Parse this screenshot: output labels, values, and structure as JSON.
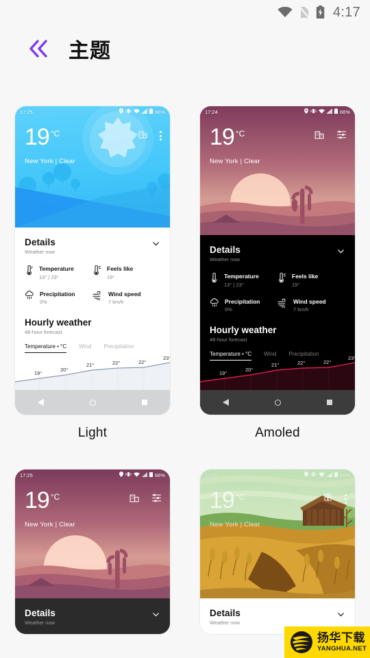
{
  "status_bar": {
    "time": "4:17",
    "icons": [
      "wifi-icon",
      "sim-off-icon",
      "battery-charging-icon"
    ]
  },
  "app_bar": {
    "back_label": "«",
    "title": "主题"
  },
  "preview": {
    "mini_status": {
      "battery": "66%",
      "icons": [
        "location-icon",
        "vibrate-icon",
        "wifi-icon",
        "signal-icon",
        "battery-icon"
      ]
    },
    "temperature": "19",
    "unit": "°C",
    "location": "New York | Clear",
    "details": {
      "title": "Details",
      "subtitle": "Weather now",
      "items": [
        {
          "icon": "thermometer-icon",
          "label": "Temperature",
          "value": "13° | 23°"
        },
        {
          "icon": "feels-like-icon",
          "label": "Feels like",
          "value": "19°"
        },
        {
          "icon": "precipitation-icon",
          "label": "Precipitation",
          "value": "0%"
        },
        {
          "icon": "wind-icon",
          "label": "Wind speed",
          "value": "7 km/h"
        }
      ]
    },
    "hourly": {
      "title": "Hourly weather",
      "subtitle": "48-hour forecast",
      "tabs": [
        "Temperature • °C",
        "Wind",
        "Precipitation"
      ],
      "active_tab": "Temperature • °C"
    },
    "nav_buttons": [
      "back-triangle",
      "home-circle",
      "recents-square"
    ]
  },
  "chart_data": {
    "type": "line",
    "title": "Hourly weather",
    "subtitle": "48-hour forecast",
    "xlabel": "",
    "ylabel": "Temperature (°C)",
    "x": [
      1,
      2,
      3,
      4,
      5,
      6
    ],
    "values": [
      19,
      20,
      21,
      22,
      22,
      23
    ],
    "point_labels": [
      "19°",
      "20°",
      "21°",
      "22°",
      "22°",
      "23°"
    ],
    "ylim": [
      18,
      24
    ],
    "grid": true,
    "legend": "none",
    "series": [
      {
        "name": "Temperature • °C",
        "values": [
          19,
          20,
          21,
          22,
          22,
          23
        ]
      }
    ]
  },
  "themes": [
    {
      "id": "light",
      "caption": "Light",
      "clock": "17:25",
      "scene": "blue-hills-sun",
      "panel_bg": "#ffffff",
      "text_color": "#111111",
      "sub_color": "#8a8a8a",
      "chart_color": "#8e9bb3",
      "nav_bg": "#d2d4d6",
      "nav_fg": "#ffffff",
      "hero_icons": [
        "city-icon",
        "overflow-menu-icon"
      ]
    },
    {
      "id": "amoled",
      "caption": "Amoled",
      "clock": "17:24",
      "scene": "desert-sunset",
      "panel_bg": "#000000",
      "text_color": "#ffffff",
      "sub_color": "#8d8d8d",
      "chart_color": "#d81e48",
      "nav_bg": "#3c3c3c",
      "nav_fg": "#d6d6d6",
      "hero_icons": [
        "city-icon",
        "list-icon"
      ]
    },
    {
      "id": "dark",
      "caption": "",
      "clock": "17:25",
      "scene": "desert-sunset",
      "panel_bg": "#2b2b2b",
      "text_color": "#ffffff",
      "sub_color": "#9a9a9a",
      "chart_color": "#d81e48",
      "nav_bg": "#2b2b2b",
      "nav_fg": "#d6d6d6",
      "hero_icons": [
        "city-icon",
        "list-icon"
      ]
    },
    {
      "id": "farm",
      "caption": "",
      "clock": "17:25",
      "scene": "wheat-field-barn",
      "panel_bg": "#ffffff",
      "text_color": "#111111",
      "sub_color": "#8a8a8a",
      "chart_color": "#8e9bb3",
      "nav_bg": "#d2d4d6",
      "nav_fg": "#ffffff",
      "hero_icons": [
        "city-icon",
        "overflow-menu-icon"
      ]
    }
  ],
  "watermark": {
    "cn": "扬华下载",
    "en": "YANGHUA.NET",
    "bg": "#ffd800"
  }
}
